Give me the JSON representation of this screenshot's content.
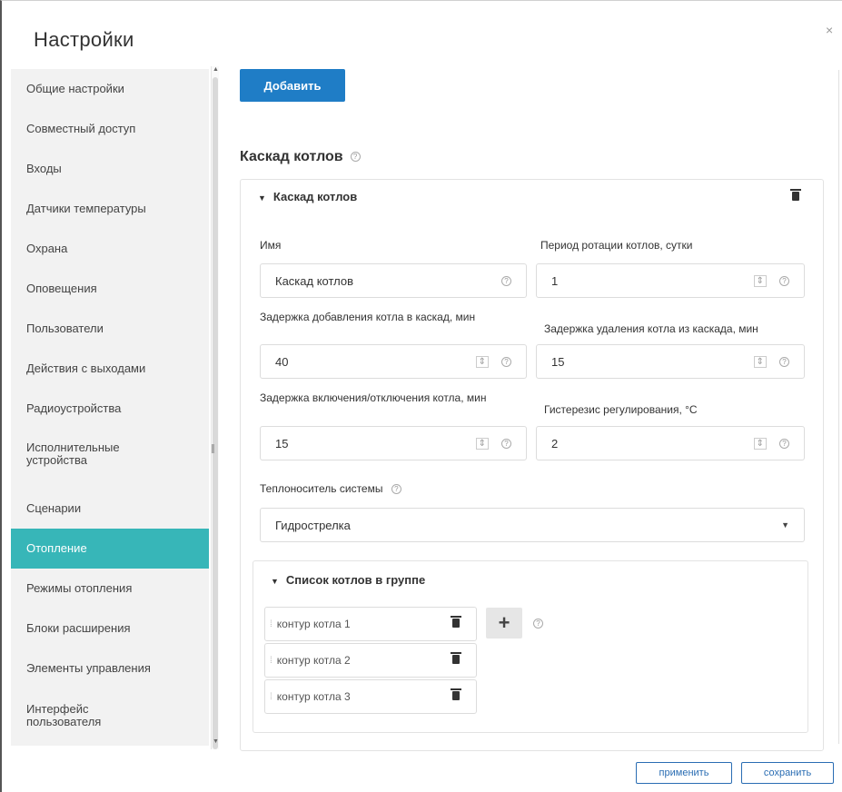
{
  "dialog": {
    "title": "Настройки",
    "close_label": "×"
  },
  "sidebar": {
    "items": [
      {
        "label": "Общие настройки"
      },
      {
        "label": "Совместный доступ"
      },
      {
        "label": "Входы"
      },
      {
        "label": "Датчики температуры"
      },
      {
        "label": "Охрана"
      },
      {
        "label": "Оповещения"
      },
      {
        "label": "Пользователи"
      },
      {
        "label": "Действия с выходами"
      },
      {
        "label": "Радиоустройства"
      },
      {
        "label": "Исполнительные устройства"
      },
      {
        "label": "Сценарии"
      },
      {
        "label": "Отопление",
        "active": true
      },
      {
        "label": "Режимы отопления"
      },
      {
        "label": "Блоки расширения"
      },
      {
        "label": "Элементы управления"
      },
      {
        "label": "Интерфейс пользователя"
      }
    ]
  },
  "toolbar": {
    "add_label": "Добавить"
  },
  "section": {
    "title": "Каскад котлов"
  },
  "panel": {
    "header": "Каскад котлов",
    "fields": {
      "name": {
        "label": "Имя",
        "value": "Каскад котлов"
      },
      "rotation_period": {
        "label": "Период ротации котлов, сутки",
        "value": "1"
      },
      "add_delay": {
        "label": "Задержка добавления котла в каскад, мин",
        "value": "40"
      },
      "remove_delay": {
        "label": "Задержка удаления котла из каскада, мин",
        "value": "15"
      },
      "onoff_delay": {
        "label": "Задержка включения/отключения котла, мин",
        "value": "15"
      },
      "hysteresis": {
        "label": "Гистерезис регулирования, °С",
        "value": "2"
      },
      "coolant": {
        "label": "Теплоноситель системы",
        "value": "Гидрострелка"
      }
    },
    "boiler_group": {
      "header": "Список котлов в группе",
      "items": [
        {
          "name": "контур котла 1"
        },
        {
          "name": "контур котла 2"
        },
        {
          "name": "контур котла 3"
        }
      ],
      "add_label": "+"
    }
  },
  "footer": {
    "apply_label": "применить",
    "save_label": "сохранить"
  }
}
